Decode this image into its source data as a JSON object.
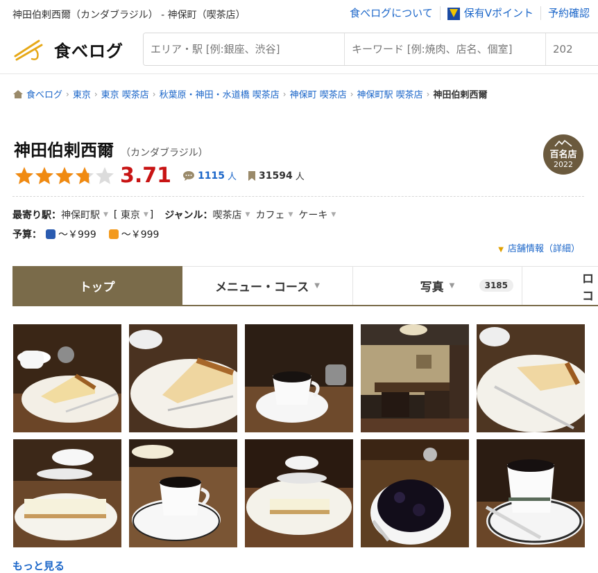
{
  "topbar": {
    "title": "神田伯剌西爾（カンダブラジル） - 神保町（喫茶店）",
    "link_about": "食べログについて",
    "link_points": "保有Vポイント",
    "link_reserve": "予約確認"
  },
  "header": {
    "logo_text": "食べログ",
    "search_area_placeholder": "エリア・駅 [例:銀座、渋谷]",
    "search_keyword_placeholder": "キーワード [例:焼肉、店名、個室]",
    "search_date_placeholder": "202"
  },
  "breadcrumb": [
    "食べログ",
    "東京",
    "東京 喫茶店",
    "秋葉原・神田・水道橋 喫茶店",
    "神保町 喫茶店",
    "神保町駅 喫茶店",
    "神田伯剌西爾"
  ],
  "restaurant": {
    "name": "神田伯剌西爾",
    "kana": "（カンダブラジル）",
    "badge_label": "百名店",
    "badge_year": "2022",
    "rating": 3.71,
    "rating_text": "3.71",
    "reviews_count": "1115",
    "reviews_unit": "人",
    "saves_count": "31594",
    "saves_unit": "人"
  },
  "info": {
    "station_label": "最寄り駅：",
    "station": "神保町駅",
    "bracket_open": "[",
    "area": "東京",
    "bracket_close": "]",
    "genre_label": "ジャンル：",
    "genres": [
      "喫茶店",
      "カフェ",
      "ケーキ"
    ],
    "budget_label": "予算：",
    "budget_dinner": "～￥999",
    "budget_lunch": "～￥999",
    "store_info_link": "店舗情報（詳細）"
  },
  "tabs": [
    {
      "label": "トップ",
      "active": true
    },
    {
      "label": "メニュー・コース"
    },
    {
      "label": "写真",
      "count": "3185"
    },
    {
      "label": "ロコ"
    }
  ],
  "photos": [
    {
      "name": "photo-cheesecake-cup"
    },
    {
      "name": "photo-cheesecake-slice"
    },
    {
      "name": "photo-coffee-cup"
    },
    {
      "name": "photo-interior"
    },
    {
      "name": "photo-cheesecake-fork"
    },
    {
      "name": "photo-rare-cheesecake"
    },
    {
      "name": "photo-coffee-white-cup"
    },
    {
      "name": "photo-cheesecake-table"
    },
    {
      "name": "photo-dark-dessert"
    },
    {
      "name": "photo-coffee-spoon"
    }
  ],
  "more_link": "もっと見る",
  "colors": {
    "accent": "#7a6b4a",
    "score": "#c81414",
    "star": "#f08a11",
    "link": "#1b66c9"
  }
}
